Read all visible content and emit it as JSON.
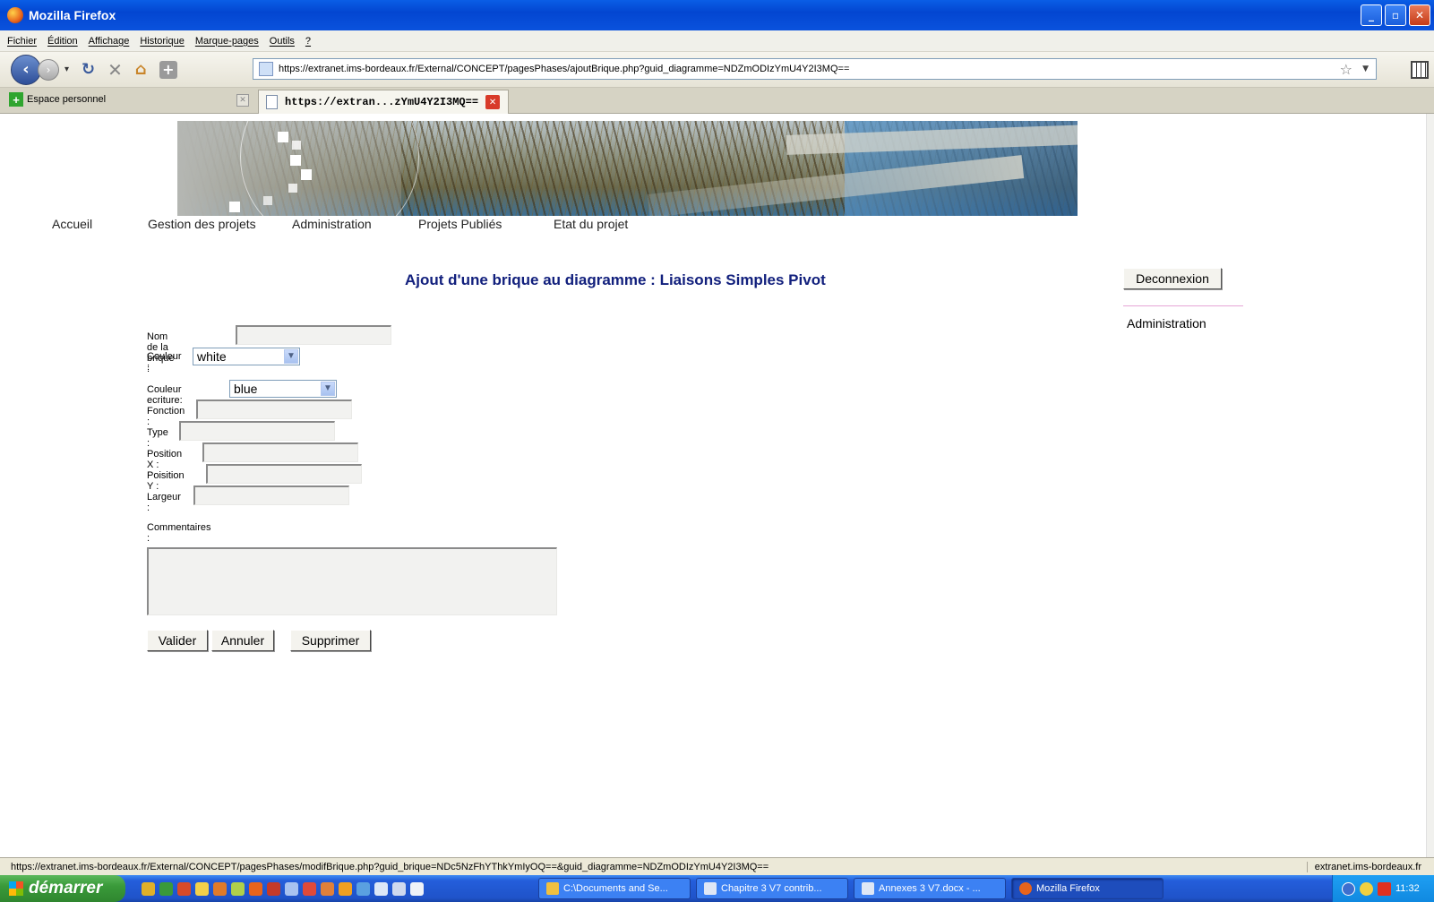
{
  "window": {
    "title": "Mozilla Firefox"
  },
  "menubar": [
    "Fichier",
    "Édition",
    "Affichage",
    "Historique",
    "Marque-pages",
    "Outils",
    "?"
  ],
  "urlbar": {
    "url": "https://extranet.ims-bordeaux.fr/External/CONCEPT/pagesPhases/ajoutBrique.php?guid_diagramme=NDZmODIzYmU4Y2I3MQ=="
  },
  "bookmarks": {
    "item": "Espace personnel"
  },
  "tabs": {
    "active_label": "https://extran...zYmU4Y2I3MQ=="
  },
  "site_nav": [
    "Accueil",
    "Gestion des projets",
    "Administration",
    "Projets Publiés",
    "Etat du projet"
  ],
  "page": {
    "title": "Ajout d'une brique au diagramme : Liaisons Simples Pivot"
  },
  "sidebar": {
    "logout": "Deconnexion",
    "link": "Administration"
  },
  "form": {
    "nom_label": "Nom de la brique :",
    "nom_value": "",
    "couleur_label": "Couleur :",
    "couleur_value": "white",
    "couleur_ecriture_label": "Couleur ecriture:",
    "couleur_ecriture_value": "blue",
    "fonction_label": "Fonction :",
    "type_label": "Type :",
    "posx_label": "Position X :",
    "posy_label": "Poisition Y :",
    "largeur_label": "Largeur :",
    "commentaires_label": "Commentaires :"
  },
  "buttons": {
    "valider": "Valider",
    "annuler": "Annuler",
    "supprimer": "Supprimer"
  },
  "statusbar": {
    "url": "https://extranet.ims-bordeaux.fr/External/CONCEPT/pagesPhases/modifBrique.php?guid_brique=NDc5NzFhYThkYmIyOQ==&guid_diagramme=NDZmODIzYmU4Y2I3MQ==",
    "host": "extranet.ims-bordeaux.fr"
  },
  "taskbar": {
    "start": "démarrer",
    "tasks": [
      "C:\\Documents and Se...",
      "Chapitre 3 V7 contrib...",
      "Annexes 3 V7.docx - ...",
      "Mozilla Firefox"
    ],
    "clock": "11:32"
  }
}
